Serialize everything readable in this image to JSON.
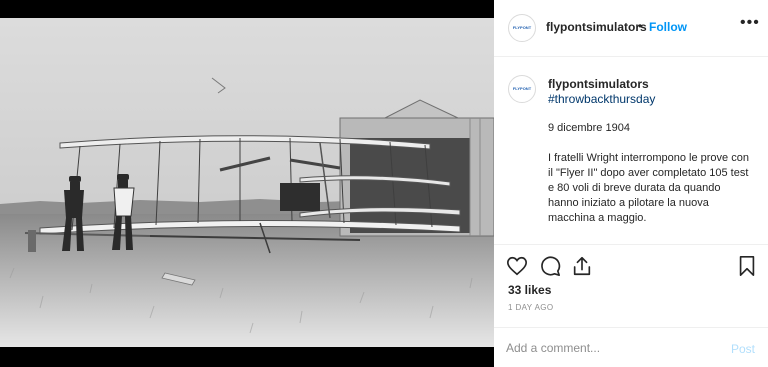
{
  "post": {
    "photo_alt": "Wright Flyer II photograph"
  },
  "header": {
    "username": "flypontsimulators",
    "separator": "•",
    "follow_label": "Follow",
    "more_label": "•••",
    "avatar_text": "FLYPONT"
  },
  "caption": {
    "username": "flypontsimulators",
    "hashtag": "#throwbackthursday",
    "date": "9 dicembre 1904",
    "body": "I fratelli Wright interrompono le prove con il \"Flyer II\" dopo aver completato 105 test e 80 voli di breve durata da quando hanno iniziato a pilotare la nuova macchina a maggio."
  },
  "actions": {
    "like_icon": "heart-icon",
    "comment_icon": "comment-icon",
    "share_icon": "share-icon",
    "save_icon": "bookmark-icon",
    "likes_text": "33 likes",
    "time_text": "1 DAY AGO"
  },
  "comment": {
    "placeholder": "Add a comment...",
    "post_label": "Post"
  },
  "colors": {
    "accent": "#0095f6",
    "hashtag": "#00376b",
    "muted": "#8e8e8e",
    "post_disabled": "#b2dffc"
  }
}
